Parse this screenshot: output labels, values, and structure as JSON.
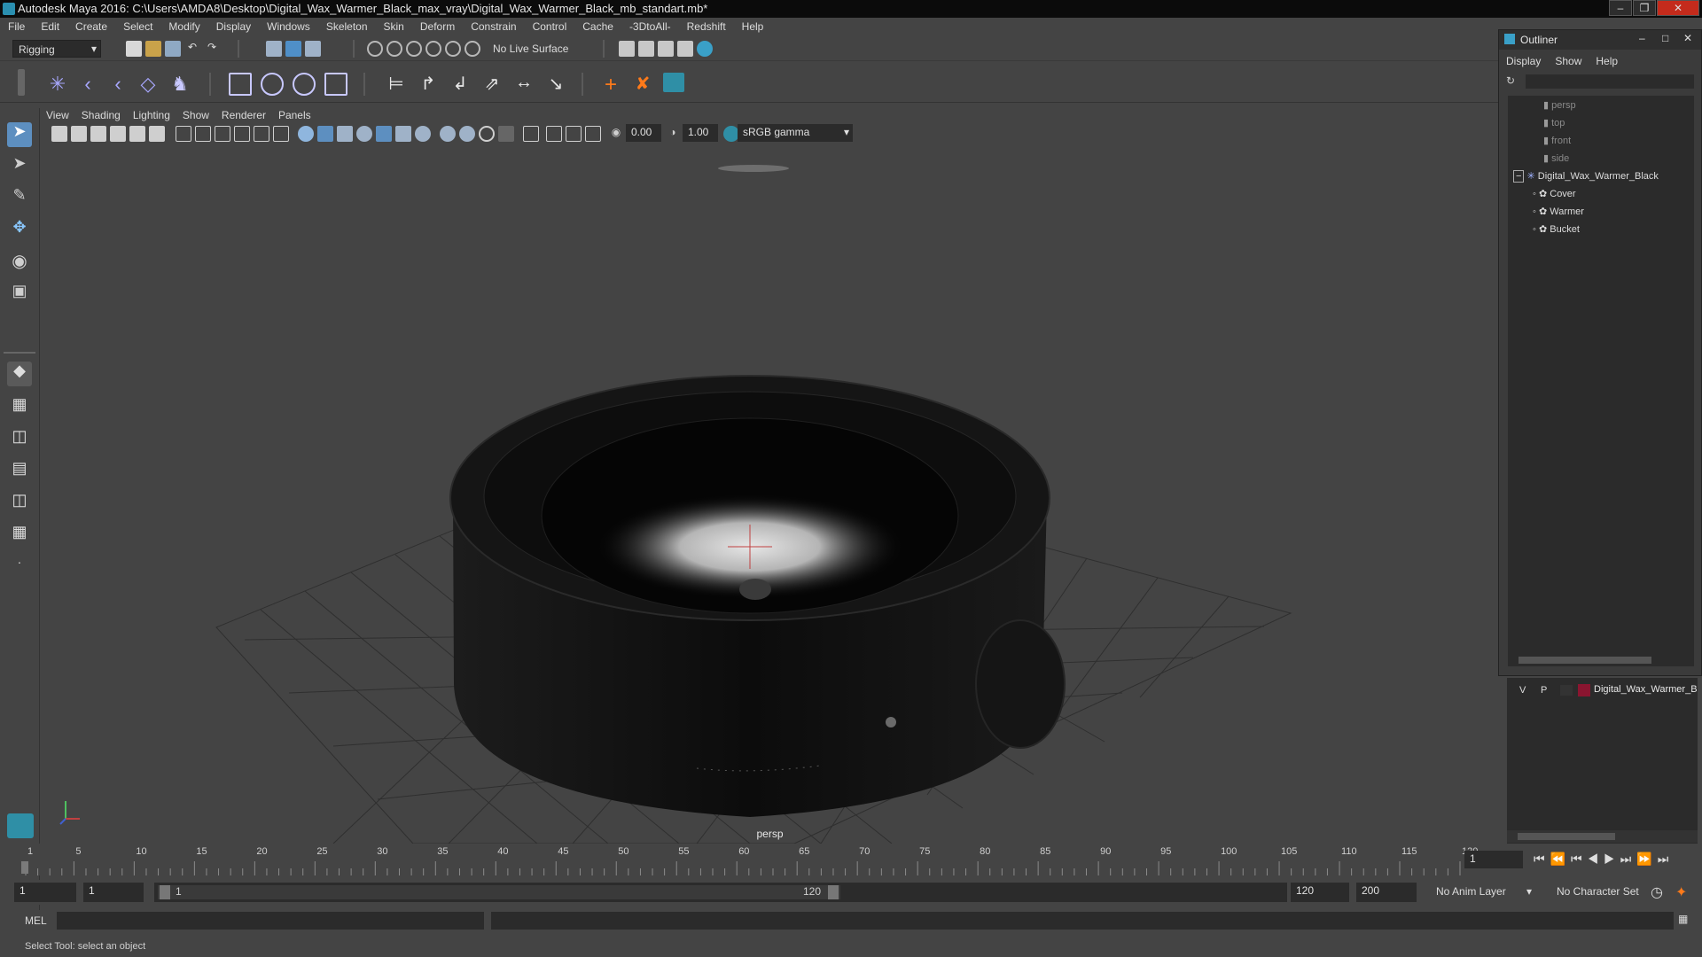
{
  "window": {
    "title": "Autodesk Maya 2016: C:\\Users\\AMDA8\\Desktop\\Digital_Wax_Warmer_Black_max_vray\\Digital_Wax_Warmer_Black_mb_standart.mb*"
  },
  "menubar": [
    "File",
    "Edit",
    "Create",
    "Select",
    "Modify",
    "Display",
    "Windows",
    "Skeleton",
    "Skin",
    "Deform",
    "Constrain",
    "Control",
    "Cache",
    "-3DtoAll-",
    "Redshift",
    "Help"
  ],
  "statusline": {
    "mode": "Rigging",
    "live_surface": "No Live Surface"
  },
  "panel_menu": [
    "View",
    "Shading",
    "Lighting",
    "Show",
    "Renderer",
    "Panels"
  ],
  "panel_toolbar": {
    "exposure": "0.00",
    "gamma": "1.00",
    "color_space": "sRGB gamma"
  },
  "viewport": {
    "camera_label": "persp"
  },
  "outliner": {
    "title": "Outliner",
    "menu": [
      "Display",
      "Show",
      "Help"
    ],
    "cameras": [
      "persp",
      "top",
      "front",
      "side"
    ],
    "group": "Digital_Wax_Warmer_Black",
    "children": [
      "Cover",
      "Warmer",
      "Bucket"
    ]
  },
  "layers": {
    "v": "V",
    "p": "P",
    "name": "Digital_Wax_Warmer_B"
  },
  "timeline": {
    "ticks": [
      "1",
      "5",
      "10",
      "15",
      "20",
      "25",
      "30",
      "35",
      "40",
      "45",
      "50",
      "55",
      "60",
      "65",
      "70",
      "75",
      "80",
      "85",
      "90",
      "95",
      "100",
      "105",
      "110",
      "115",
      "120"
    ],
    "current_frame": "1"
  },
  "range": {
    "start": "1",
    "playback_start": "1",
    "slider_start": "1",
    "slider_end": "120",
    "playback_end": "120",
    "end": "200",
    "anim_layer": "No Anim Layer",
    "character_set": "No Character Set"
  },
  "command": {
    "label": "MEL"
  },
  "help_line": "Select Tool: select an object"
}
